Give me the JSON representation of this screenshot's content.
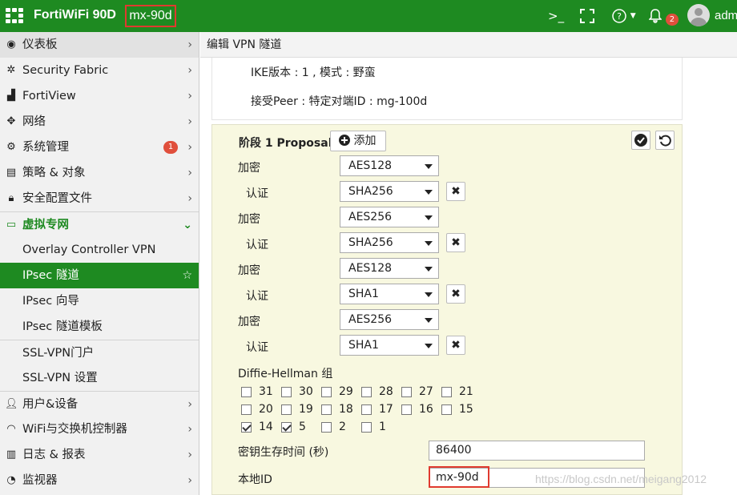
{
  "topbar": {
    "brand": "FortiWiFi 90D",
    "hostname": "mx-90d",
    "cli_icon": "terminal-icon",
    "fullscreen_icon": "fullscreen-icon",
    "help_icon": "help-icon",
    "notify_icon": "bell-icon",
    "notify_count": "2",
    "user": "admin"
  },
  "sidebar": {
    "items": [
      {
        "label": "仪表板",
        "icon": "dashboard-icon"
      },
      {
        "label": "Security Fabric",
        "icon": "fabric-icon"
      },
      {
        "label": "FortiView",
        "icon": "chart-icon"
      },
      {
        "label": "网络",
        "icon": "network-icon"
      },
      {
        "label": "系统管理",
        "icon": "gear-icon",
        "badge": "1"
      },
      {
        "label": "策略 & 对象",
        "icon": "policy-icon"
      },
      {
        "label": "安全配置文件",
        "icon": "lock-icon"
      },
      {
        "label": "虚拟专网",
        "icon": "laptop-icon"
      },
      {
        "label": "Overlay Controller VPN"
      },
      {
        "label": "IPsec 隧道"
      },
      {
        "label": "IPsec 向导"
      },
      {
        "label": "IPsec 隧道模板"
      },
      {
        "label": "SSL-VPN门户"
      },
      {
        "label": "SSL-VPN 设置"
      },
      {
        "label": "用户&设备",
        "icon": "user-icon"
      },
      {
        "label": "WiFi与交换机控制器",
        "icon": "wifi-icon"
      },
      {
        "label": "日志 & 报表",
        "icon": "report-icon"
      },
      {
        "label": "监视器",
        "icon": "monitor-icon"
      }
    ]
  },
  "header": {
    "title": "编辑 VPN 隧道"
  },
  "info": {
    "ike_line": "IKE版本 : 1 , 模式 : 野蛮",
    "peer_line": "接受Peer : 特定对端ID : mg-100d"
  },
  "phase1": {
    "title": "阶段 1 Proposal",
    "add_label": "添加",
    "encrypt_label": "加密",
    "auth_label": "认证",
    "proposals": [
      {
        "encryption": "AES128",
        "auth": "SHA256"
      },
      {
        "encryption": "AES256",
        "auth": "SHA256"
      },
      {
        "encryption": "AES128",
        "auth": "SHA1"
      },
      {
        "encryption": "AES256",
        "auth": "SHA1"
      }
    ],
    "dh_label": "Diffie-Hellman 组",
    "dh_groups": [
      {
        "value": "31",
        "checked": false
      },
      {
        "value": "30",
        "checked": false
      },
      {
        "value": "29",
        "checked": false
      },
      {
        "value": "28",
        "checked": false
      },
      {
        "value": "27",
        "checked": false
      },
      {
        "value": "21",
        "checked": false
      },
      {
        "value": "20",
        "checked": false
      },
      {
        "value": "19",
        "checked": false
      },
      {
        "value": "18",
        "checked": false
      },
      {
        "value": "17",
        "checked": false
      },
      {
        "value": "16",
        "checked": false
      },
      {
        "value": "15",
        "checked": false
      },
      {
        "value": "14",
        "checked": true
      },
      {
        "value": "5",
        "checked": true
      },
      {
        "value": "2",
        "checked": false
      },
      {
        "value": "1",
        "checked": false
      }
    ],
    "keylife_label": "密钥生存时间 (秒)",
    "keylife_value": "86400",
    "localid_label": "本地ID",
    "localid_value": "mx-90d"
  },
  "watermark": "https://blog.csdn.net/meigang2012",
  "colors": {
    "brand_green": "#1e8a21",
    "highlight_red": "#e03a2f",
    "panel_bg": "#f8f8e0"
  }
}
